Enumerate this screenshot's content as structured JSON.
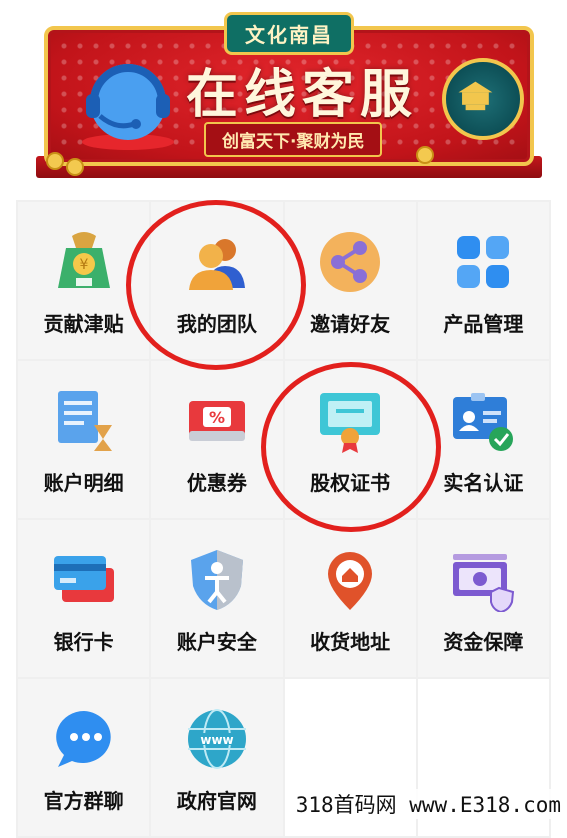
{
  "banner": {
    "tag": "文化南昌",
    "title": "在线客服",
    "slogan": "创富天下·聚财为民"
  },
  "menu": [
    {
      "label": "贡献津贴",
      "icon": "money-bag-icon"
    },
    {
      "label": "我的团队",
      "icon": "team-icon"
    },
    {
      "label": "邀请好友",
      "icon": "share-icon"
    },
    {
      "label": "产品管理",
      "icon": "grid-apps-icon"
    },
    {
      "label": "账户明细",
      "icon": "ledger-hourglass-icon"
    },
    {
      "label": "优惠券",
      "icon": "coupon-icon"
    },
    {
      "label": "股权证书",
      "icon": "certificate-icon"
    },
    {
      "label": "实名认证",
      "icon": "id-verified-icon"
    },
    {
      "label": "银行卡",
      "icon": "bank-card-icon"
    },
    {
      "label": "账户安全",
      "icon": "shield-user-icon"
    },
    {
      "label": "收货地址",
      "icon": "location-home-icon"
    },
    {
      "label": "资金保障",
      "icon": "banknote-shield-icon"
    },
    {
      "label": "官方群聊",
      "icon": "chat-bubble-icon"
    },
    {
      "label": "政府官网",
      "icon": "www-globe-icon"
    }
  ],
  "watermark": "318首码网 www.E318.com",
  "colors": {
    "accent_red": "#e2201d",
    "banner_red": "#c2141a",
    "gold": "#f2c64d"
  }
}
